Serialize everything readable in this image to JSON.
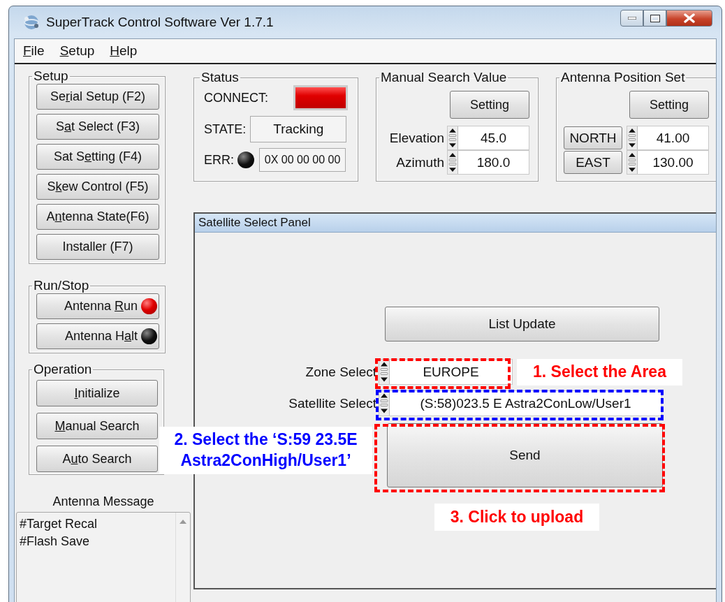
{
  "window": {
    "title": "SuperTrack Control Software Ver 1.7.1"
  },
  "menu": [
    {
      "key": "F",
      "after": "ile"
    },
    {
      "key": "S",
      "after": "etup"
    },
    {
      "key": "H",
      "after": "elp"
    }
  ],
  "setup": {
    "title": "Setup",
    "buttons": [
      {
        "before": "Se",
        "key": "r",
        "after": "ial Setup (F2)"
      },
      {
        "before": "S",
        "key": "a",
        "after": "t Select (F3)"
      },
      {
        "before": "Sat S",
        "key": "e",
        "after": "tting (F4)"
      },
      {
        "before": "S",
        "key": "k",
        "after": "ew Control (F5)"
      },
      {
        "before": "A",
        "key": "n",
        "after": "tenna State(F6)"
      },
      {
        "text": "Installer (F7)"
      }
    ]
  },
  "run_stop": {
    "title": "Run/Stop",
    "buttons": [
      {
        "before": "Antenna ",
        "key": "R",
        "after": "un",
        "on": true
      },
      {
        "before": "Antenna H",
        "key": "a",
        "after": "lt",
        "on": false
      }
    ]
  },
  "operation": {
    "title": "Operation",
    "buttons": [
      {
        "key": "I",
        "after": "nitialize"
      },
      {
        "key": "M",
        "after": "anual Search"
      },
      {
        "before": "A",
        "key": "u",
        "after": "to Search"
      }
    ]
  },
  "antenna_message": {
    "title": "Antenna Message",
    "lines": [
      "#Target Recal",
      "#Flash Save"
    ]
  },
  "status": {
    "title": "Status",
    "connect": {
      "label": "CONNECT:",
      "on": true
    },
    "state": {
      "label": "STATE:",
      "value": "Tracking"
    },
    "err": {
      "label": "ERR:",
      "on": false,
      "value": "0X 00 00 00 00"
    }
  },
  "manual_search_value": {
    "title": "Manual Search Value",
    "button": "Setting",
    "fields": [
      {
        "label": "Elevation",
        "value": "45.0"
      },
      {
        "label": "Azimuth",
        "value": "180.0"
      }
    ]
  },
  "antenna_position_set": {
    "title": "Antenna Position Set",
    "button": "Setting",
    "fields": [
      {
        "label": "NORTH",
        "value": "41.00"
      },
      {
        "label": "EAST",
        "value": "130.00"
      }
    ]
  },
  "satellite_select_panel": {
    "title": "Satellite Select Panel",
    "list_update": "List Update",
    "zone_select": {
      "label": "Zone Select",
      "value": "EUROPE"
    },
    "satellite_select": {
      "label": "Satellite Select",
      "value": "(S:58)023.5 E Astra2ConLow/User1"
    },
    "send": "Send"
  },
  "annotations": [
    {
      "kind": "box",
      "color": "#ff0000"
    },
    {
      "kind": "note",
      "text": "1. Select the Area",
      "color": "#ff0000"
    },
    {
      "kind": "box",
      "color": "#0000ff"
    },
    {
      "kind": "note",
      "text": "2. Select the ‘S:59 23.5E Astra2ConHigh/User1’",
      "color": "#0000ff"
    },
    {
      "kind": "box",
      "color": "#ff0000"
    },
    {
      "kind": "note",
      "text": "3. Click to upload",
      "color": "#ff0000"
    }
  ]
}
